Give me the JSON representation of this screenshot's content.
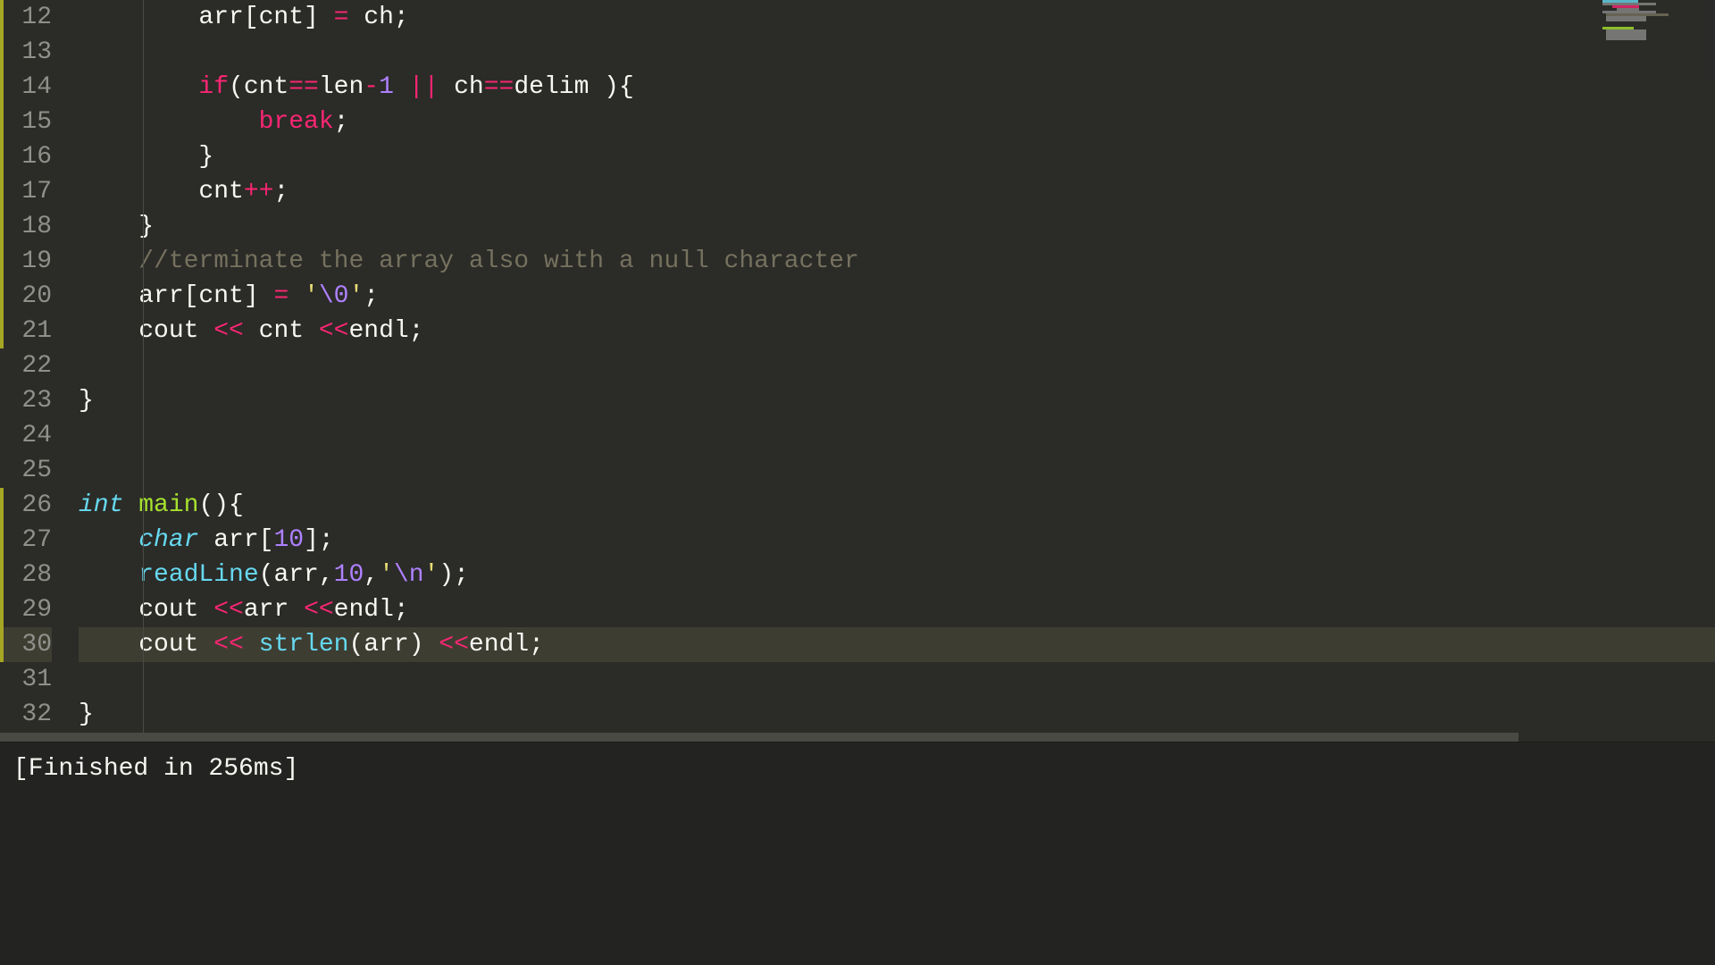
{
  "lines": [
    {
      "n": 12,
      "modified": true,
      "tokens": [
        {
          "t": "        arr[cnt] ",
          "c": "txt"
        },
        {
          "t": "=",
          "c": "op"
        },
        {
          "t": " ch;",
          "c": "txt"
        }
      ]
    },
    {
      "n": 13,
      "modified": true,
      "tokens": []
    },
    {
      "n": 14,
      "modified": true,
      "tokens": [
        {
          "t": "        ",
          "c": "txt"
        },
        {
          "t": "if",
          "c": "kw2"
        },
        {
          "t": "(cnt",
          "c": "txt"
        },
        {
          "t": "==",
          "c": "op"
        },
        {
          "t": "len",
          "c": "txt"
        },
        {
          "t": "-",
          "c": "op"
        },
        {
          "t": "1",
          "c": "num"
        },
        {
          "t": " ",
          "c": "txt"
        },
        {
          "t": "||",
          "c": "op"
        },
        {
          "t": " ch",
          "c": "txt"
        },
        {
          "t": "==",
          "c": "op"
        },
        {
          "t": "delim ){",
          "c": "txt"
        }
      ]
    },
    {
      "n": 15,
      "modified": true,
      "tokens": [
        {
          "t": "            ",
          "c": "txt"
        },
        {
          "t": "break",
          "c": "kw2"
        },
        {
          "t": ";",
          "c": "txt"
        }
      ]
    },
    {
      "n": 16,
      "modified": true,
      "tokens": [
        {
          "t": "        }",
          "c": "txt"
        }
      ]
    },
    {
      "n": 17,
      "modified": true,
      "tokens": [
        {
          "t": "        cnt",
          "c": "txt"
        },
        {
          "t": "++",
          "c": "op"
        },
        {
          "t": ";",
          "c": "txt"
        }
      ]
    },
    {
      "n": 18,
      "modified": true,
      "tokens": [
        {
          "t": "    }",
          "c": "txt"
        }
      ]
    },
    {
      "n": 19,
      "modified": true,
      "tokens": [
        {
          "t": "    ",
          "c": "txt"
        },
        {
          "t": "//terminate the array also with a null character",
          "c": "com"
        }
      ]
    },
    {
      "n": 20,
      "modified": true,
      "tokens": [
        {
          "t": "    arr[cnt] ",
          "c": "txt"
        },
        {
          "t": "=",
          "c": "op"
        },
        {
          "t": " ",
          "c": "txt"
        },
        {
          "t": "'",
          "c": "str"
        },
        {
          "t": "\\0",
          "c": "esc"
        },
        {
          "t": "'",
          "c": "str"
        },
        {
          "t": ";",
          "c": "txt"
        }
      ]
    },
    {
      "n": 21,
      "modified": true,
      "tokens": [
        {
          "t": "    cout ",
          "c": "txt"
        },
        {
          "t": "<<",
          "c": "op"
        },
        {
          "t": " cnt ",
          "c": "txt"
        },
        {
          "t": "<<",
          "c": "op"
        },
        {
          "t": "endl;",
          "c": "txt"
        }
      ]
    },
    {
      "n": 22,
      "modified": false,
      "tokens": []
    },
    {
      "n": 23,
      "modified": false,
      "tokens": [
        {
          "t": "}",
          "c": "txt"
        }
      ]
    },
    {
      "n": 24,
      "modified": false,
      "tokens": []
    },
    {
      "n": 25,
      "modified": false,
      "tokens": []
    },
    {
      "n": 26,
      "modified": true,
      "tokens": [
        {
          "t": "int",
          "c": "type"
        },
        {
          "t": " ",
          "c": "txt"
        },
        {
          "t": "main",
          "c": "name"
        },
        {
          "t": "(){",
          "c": "txt"
        }
      ]
    },
    {
      "n": 27,
      "modified": true,
      "tokens": [
        {
          "t": "    ",
          "c": "txt"
        },
        {
          "t": "char",
          "c": "type"
        },
        {
          "t": " arr[",
          "c": "txt"
        },
        {
          "t": "10",
          "c": "num"
        },
        {
          "t": "];",
          "c": "txt"
        }
      ]
    },
    {
      "n": 28,
      "modified": true,
      "tokens": [
        {
          "t": "    ",
          "c": "txt"
        },
        {
          "t": "readLine",
          "c": "call"
        },
        {
          "t": "(arr,",
          "c": "txt"
        },
        {
          "t": "10",
          "c": "num"
        },
        {
          "t": ",",
          "c": "txt"
        },
        {
          "t": "'",
          "c": "str"
        },
        {
          "t": "\\n",
          "c": "esc"
        },
        {
          "t": "'",
          "c": "str"
        },
        {
          "t": ");",
          "c": "txt"
        }
      ]
    },
    {
      "n": 29,
      "modified": true,
      "tokens": [
        {
          "t": "    cout ",
          "c": "txt"
        },
        {
          "t": "<<",
          "c": "op"
        },
        {
          "t": "arr ",
          "c": "txt"
        },
        {
          "t": "<<",
          "c": "op"
        },
        {
          "t": "endl;",
          "c": "txt"
        }
      ]
    },
    {
      "n": 30,
      "modified": true,
      "current": true,
      "tokens": [
        {
          "t": "    cout",
          "c": "txt"
        },
        {
          "t": " ",
          "c": "dim"
        },
        {
          "t": "<<",
          "c": "op"
        },
        {
          "t": " ",
          "c": "dim"
        },
        {
          "t": "strlen",
          "c": "call"
        },
        {
          "t": "(arr) ",
          "c": "txt"
        },
        {
          "t": "<<",
          "c": "op"
        },
        {
          "t": "endl;",
          "c": "txt"
        }
      ]
    },
    {
      "n": 31,
      "modified": false,
      "tokens": []
    },
    {
      "n": 32,
      "modified": false,
      "tokens": [
        {
          "t": "}",
          "c": "txt"
        }
      ]
    }
  ],
  "output": {
    "status": "[Finished in 256ms]"
  }
}
